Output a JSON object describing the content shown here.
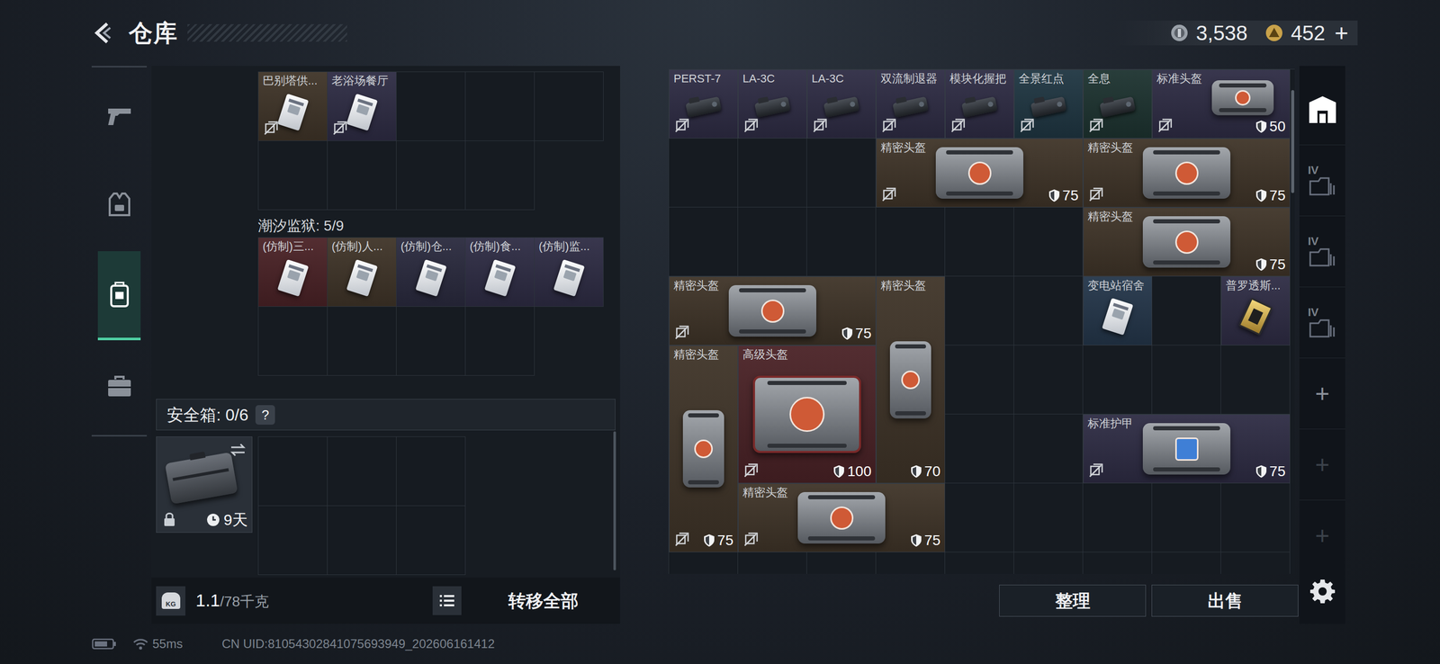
{
  "header": {
    "title": "仓库"
  },
  "currency": {
    "silver": "3,538",
    "gold": "452",
    "add": "+"
  },
  "nav": [
    {
      "kind": "weapon",
      "selected": false
    },
    {
      "kind": "gear",
      "selected": false
    },
    {
      "kind": "bag",
      "selected": true
    },
    {
      "kind": "case",
      "selected": false
    }
  ],
  "keycard_box": {
    "items": [
      {
        "name": "巴别塔供...",
        "kind": "card",
        "color": "#3f3428",
        "bound": true
      },
      {
        "name": "老浴场餐厅",
        "kind": "card",
        "color": "#2e2c44",
        "bound": true
      }
    ]
  },
  "prison_box": {
    "label": "潮汐监狱: 5/9",
    "items": [
      {
        "name": "(仿制)三...",
        "kind": "card",
        "color": "#4a2226",
        "bound": false
      },
      {
        "name": "(仿制)人...",
        "kind": "card",
        "color": "#3f3428",
        "bound": false
      },
      {
        "name": "(仿制)仓...",
        "kind": "card",
        "color": "#2a2a3e",
        "bound": false
      },
      {
        "name": "(仿制)食...",
        "kind": "card",
        "color": "#2e2c44",
        "bound": false
      },
      {
        "name": "(仿制)监...",
        "kind": "card",
        "color": "#2e2c44",
        "bound": false
      }
    ]
  },
  "safe_box": {
    "label": "安全箱: 0/6",
    "help": "?",
    "timer": "9天",
    "locked": true
  },
  "weight": {
    "icon_label": "KG",
    "current": "1.1",
    "capacity": "/78千克"
  },
  "transfer_all": "转移全部",
  "stash": {
    "items": [
      {
        "name": "PERST-7",
        "kind": "attachment",
        "slot": [
          1,
          1,
          1,
          1
        ],
        "color": "#2e2c44",
        "bound": true
      },
      {
        "name": "LA-3C",
        "kind": "attachment",
        "slot": [
          2,
          1,
          1,
          1
        ],
        "color": "#2e2c44",
        "bound": true
      },
      {
        "name": "LA-3C",
        "kind": "attachment",
        "slot": [
          3,
          1,
          1,
          1
        ],
        "color": "#2e2c44",
        "bound": true
      },
      {
        "name": "双流制退器",
        "kind": "attachment",
        "slot": [
          4,
          1,
          1,
          1
        ],
        "color": "#2e2c44",
        "bound": true
      },
      {
        "name": "模块化握把",
        "kind": "attachment",
        "slot": [
          5,
          1,
          1,
          1
        ],
        "color": "#2e2c44",
        "bound": true
      },
      {
        "name": "全景红点",
        "kind": "attachment",
        "slot": [
          6,
          1,
          1,
          1
        ],
        "color": "#1f3642",
        "bound": true
      },
      {
        "name": "全息",
        "kind": "attachment",
        "slot": [
          7,
          1,
          1,
          1
        ],
        "color": "#1d3330",
        "bound": true
      },
      {
        "name": "标准头盔",
        "kind": "helmet",
        "slot": [
          8,
          1,
          2,
          1
        ],
        "color": "#2e2c44",
        "bound": true,
        "durability": "50"
      },
      {
        "name": "精密头盔",
        "kind": "helmet",
        "slot": [
          4,
          2,
          3,
          1
        ],
        "color": "#3f3428",
        "bound": true,
        "durability": "75"
      },
      {
        "name": "精密头盔",
        "kind": "helmet",
        "slot": [
          7,
          2,
          3,
          1
        ],
        "color": "#3f3428",
        "bound": true,
        "durability": "75"
      },
      {
        "name": "精密头盔",
        "kind": "helmet",
        "slot": [
          7,
          3,
          3,
          1
        ],
        "color": "#3f3428",
        "bound": false,
        "durability": "75"
      },
      {
        "name": "精密头盔",
        "kind": "helmet",
        "slot": [
          1,
          4,
          3,
          1
        ],
        "color": "#3f3428",
        "bound": true,
        "durability": "75"
      },
      {
        "name": "精密头盔",
        "kind": "helmet",
        "slot": [
          4,
          4,
          1,
          3
        ],
        "color": "#3f3428",
        "bound": false,
        "durability": "70"
      },
      {
        "name": "变电站宿舍",
        "kind": "card",
        "slot": [
          7,
          4,
          1,
          1
        ],
        "color": "#24364a",
        "bound": false
      },
      {
        "name": "普罗透斯...",
        "kind": "chip",
        "slot": [
          9,
          4,
          1,
          1
        ],
        "color": "#2e2c44",
        "bound": false
      },
      {
        "name": "精密头盔",
        "kind": "helmet",
        "slot": [
          1,
          5,
          1,
          3
        ],
        "color": "#3f3428",
        "bound": true,
        "durability": "75"
      },
      {
        "name": "高级头盔",
        "kind": "helmet",
        "slot": [
          2,
          5,
          2,
          2
        ],
        "color": "#4a2226",
        "bound": true,
        "durability": "100"
      },
      {
        "name": "标准护甲",
        "kind": "armor",
        "slot": [
          7,
          6,
          3,
          1
        ],
        "color": "#2e2c44",
        "bound": true,
        "durability": "75"
      },
      {
        "name": "精密头盔",
        "kind": "helmet",
        "slot": [
          2,
          7,
          3,
          1
        ],
        "color": "#3f3428",
        "bound": true,
        "durability": "75"
      }
    ]
  },
  "stash_tabs": [
    {
      "kind": "home",
      "selected": true
    },
    {
      "kind": "case",
      "label": "IV",
      "selected": false
    },
    {
      "kind": "case",
      "label": "IV",
      "selected": false
    },
    {
      "kind": "case",
      "label": "IV",
      "selected": false
    },
    {
      "kind": "add",
      "label": "+",
      "selected": false,
      "disabled": false
    },
    {
      "kind": "add",
      "label": "+",
      "selected": false,
      "disabled": true
    },
    {
      "kind": "add",
      "label": "+",
      "selected": false,
      "disabled": true
    }
  ],
  "actions": [
    {
      "label": "整理"
    },
    {
      "label": "出售"
    }
  ],
  "status": {
    "ping": "55ms",
    "uid": "CN UID:81054302841075693949_202606161412"
  }
}
